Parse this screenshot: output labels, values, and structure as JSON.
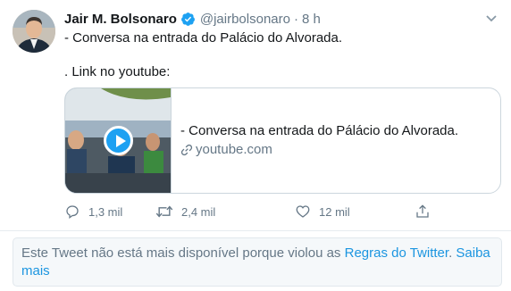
{
  "user": {
    "name": "Jair M. Bolsonaro",
    "handle": "@jairbolsonaro",
    "separator": "·",
    "time": "8 h"
  },
  "tweet": {
    "line1": "- Conversa na entrada do Palácio do Alvorada.",
    "line2": ". Link no youtube:"
  },
  "card": {
    "title": "- Conversa na entrada do Pálácio do Alvorada.",
    "domain": "youtube.com"
  },
  "actions": {
    "reply_count": "1,3 mil",
    "retweet_count": "2,4 mil",
    "like_count": "12 mil"
  },
  "notice": {
    "text_before": "Este Tweet não está mais disponível porque violou as ",
    "rules_link": "Regras do Twitter",
    "text_between": ". ",
    "learn_more_link": "Saiba mais"
  },
  "colors": {
    "accent": "#1da1f2",
    "secondary_text": "#657786",
    "link": "#1b95e0"
  },
  "icons": [
    "verified-badge-icon",
    "chevron-down-icon",
    "link-icon",
    "reply-icon",
    "retweet-icon",
    "like-icon",
    "share-icon",
    "play-icon"
  ]
}
